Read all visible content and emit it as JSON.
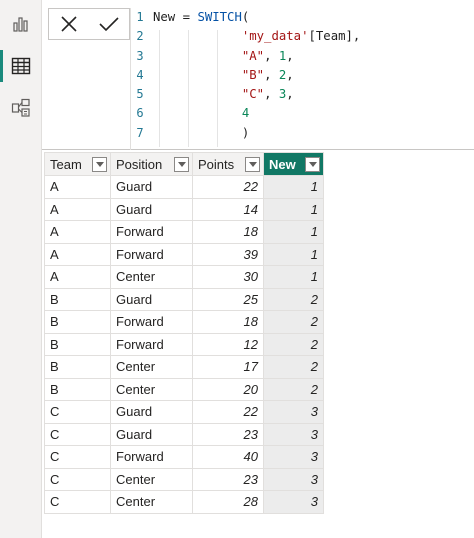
{
  "formula": {
    "line_numbers": [
      "1",
      "2",
      "3",
      "4",
      "5",
      "6",
      "7"
    ]
  },
  "table": {
    "headers": [
      "Team",
      "Position",
      "Points",
      "New"
    ],
    "rows": [
      [
        "A",
        "Guard",
        "22",
        "1"
      ],
      [
        "A",
        "Guard",
        "14",
        "1"
      ],
      [
        "A",
        "Forward",
        "18",
        "1"
      ],
      [
        "A",
        "Forward",
        "39",
        "1"
      ],
      [
        "A",
        "Center",
        "30",
        "1"
      ],
      [
        "B",
        "Guard",
        "25",
        "2"
      ],
      [
        "B",
        "Forward",
        "18",
        "2"
      ],
      [
        "B",
        "Forward",
        "12",
        "2"
      ],
      [
        "B",
        "Center",
        "17",
        "2"
      ],
      [
        "B",
        "Center",
        "20",
        "2"
      ],
      [
        "C",
        "Guard",
        "22",
        "3"
      ],
      [
        "C",
        "Guard",
        "23",
        "3"
      ],
      [
        "C",
        "Forward",
        "40",
        "3"
      ],
      [
        "C",
        "Center",
        "23",
        "3"
      ],
      [
        "C",
        "Center",
        "28",
        "3"
      ]
    ]
  },
  "icons": {
    "report_view": "bar-chart-icon",
    "data_view": "table-grid-icon",
    "model_view": "model-diagram-icon",
    "cancel": "close-icon",
    "commit": "checkmark-icon",
    "filter": "chevron-down-icon"
  },
  "colors": {
    "active_rail": "#1a8a7d",
    "new_column_header": "#117865"
  }
}
